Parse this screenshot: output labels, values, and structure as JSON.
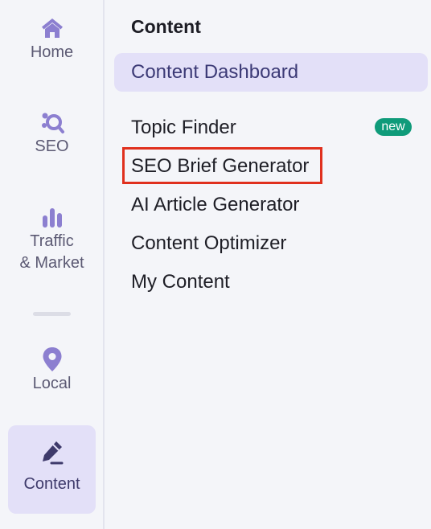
{
  "rail": {
    "items": [
      {
        "label": "Home",
        "icon": "home-icon"
      },
      {
        "label": "SEO",
        "icon": "seo-icon"
      },
      {
        "label": "Traffic\n& Market",
        "icon": "bar-chart-icon"
      },
      {
        "label": "Local",
        "icon": "location-pin-icon"
      },
      {
        "label": "Content",
        "icon": "pen-icon"
      }
    ],
    "active": "Content"
  },
  "panel": {
    "title": "Content",
    "dashboard_label": "Content Dashboard",
    "items": [
      {
        "label": "Topic Finder",
        "badge": "new"
      },
      {
        "label": "SEO Brief Generator",
        "highlighted": true
      },
      {
        "label": "AI Article Generator"
      },
      {
        "label": "Content Optimizer"
      },
      {
        "label": "My Content"
      }
    ]
  },
  "colors": {
    "accent": "#8c7fd0",
    "active_bg": "#e3e0f8",
    "badge_bg": "#0f9b7a",
    "highlight_border": "#e0301e"
  }
}
